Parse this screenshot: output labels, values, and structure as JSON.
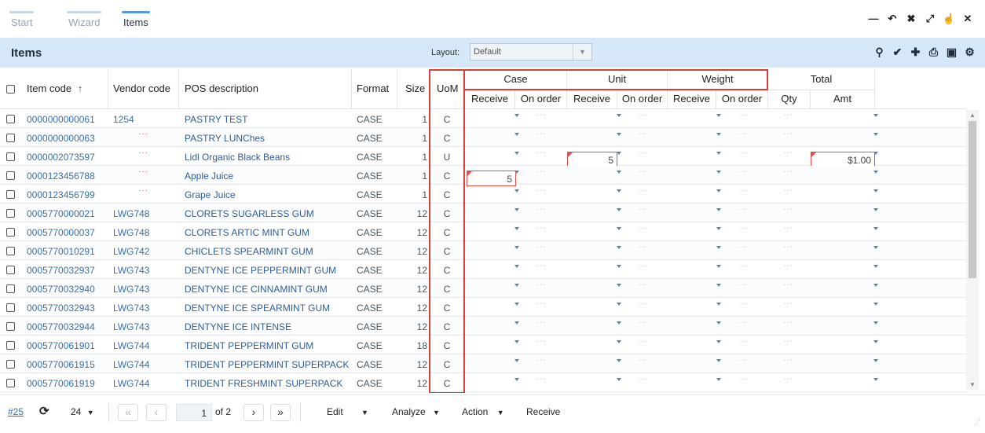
{
  "wizard": {
    "steps": [
      {
        "label": "Start"
      },
      {
        "label": "Wizard"
      },
      {
        "label": "Items"
      }
    ],
    "tools": [
      "minimize-icon",
      "undo-icon",
      "collapse-icon",
      "expand-icon",
      "pointer-icon",
      "close-icon"
    ]
  },
  "header": {
    "title": "Items",
    "layout_label": "Layout:",
    "layout_value": "Default",
    "tools": [
      "search-icon",
      "check-icon",
      "plus-icon",
      "print-icon",
      "excel-icon",
      "settings-icon"
    ]
  },
  "columns": {
    "item_code": "Item code",
    "vendor_code": "Vendor code",
    "pos_description": "POS description",
    "format": "Format",
    "size": "Size",
    "uom": "UoM",
    "groups": {
      "case": "Case",
      "unit": "Unit",
      "weight": "Weight",
      "total": "Total"
    },
    "sub": {
      "receive": "Receive",
      "on_order": "On order",
      "qty": "Qty",
      "amt": "Amt"
    },
    "sort_indicator": "↑"
  },
  "placeholder_dots": "···",
  "rows": [
    {
      "item_code": "0000000000061",
      "vendor_code": "1254",
      "description": "PASTRY TEST",
      "format": "CASE",
      "size": "1",
      "uom": "C"
    },
    {
      "item_code": "0000000000063",
      "vendor_code": "···",
      "description": "PASTRY LUNChes",
      "format": "CASE",
      "size": "1",
      "uom": "C"
    },
    {
      "item_code": "0000002073597",
      "vendor_code": "···",
      "description": "Lidl Organic Black Beans",
      "format": "CASE",
      "size": "1",
      "uom": "U",
      "unit_receive": "5",
      "total_amt": "$1.00"
    },
    {
      "item_code": "0000123456788",
      "vendor_code": "···",
      "description": "Apple Juice",
      "format": "CASE",
      "size": "1",
      "uom": "C",
      "case_receive": "5"
    },
    {
      "item_code": "0000123456799",
      "vendor_code": "···",
      "description": "Grape Juice",
      "format": "CASE",
      "size": "1",
      "uom": "C"
    },
    {
      "item_code": "0005770000021",
      "vendor_code": "LWG748",
      "description": "CLORETS SUGARLESS GUM",
      "format": "CASE",
      "size": "12",
      "uom": "C"
    },
    {
      "item_code": "0005770000037",
      "vendor_code": "LWG748",
      "description": "CLORETS ARTIC MINT GUM",
      "format": "CASE",
      "size": "12",
      "uom": "C"
    },
    {
      "item_code": "0005770010291",
      "vendor_code": "LWG742",
      "description": "CHICLETS SPEARMINT GUM",
      "format": "CASE",
      "size": "12",
      "uom": "C"
    },
    {
      "item_code": "0005770032937",
      "vendor_code": "LWG743",
      "description": "DENTYNE ICE PEPPERMINT GUM",
      "format": "CASE",
      "size": "12",
      "uom": "C"
    },
    {
      "item_code": "0005770032940",
      "vendor_code": "LWG743",
      "description": "DENTYNE ICE CINNAMINT GUM",
      "format": "CASE",
      "size": "12",
      "uom": "C"
    },
    {
      "item_code": "0005770032943",
      "vendor_code": "LWG743",
      "description": "DENTYNE ICE SPEARMINT GUM",
      "format": "CASE",
      "size": "12",
      "uom": "C"
    },
    {
      "item_code": "0005770032944",
      "vendor_code": "LWG743",
      "description": "DENTYNE ICE INTENSE",
      "format": "CASE",
      "size": "12",
      "uom": "C"
    },
    {
      "item_code": "0005770061901",
      "vendor_code": "LWG744",
      "description": "TRIDENT PEPPERMINT GUM",
      "format": "CASE",
      "size": "18",
      "uom": "C"
    },
    {
      "item_code": "0005770061915",
      "vendor_code": "LWG744",
      "description": "TRIDENT PEPPERMINT SUPERPACK",
      "format": "CASE",
      "size": "12",
      "uom": "C"
    },
    {
      "item_code": "0005770061919",
      "vendor_code": "LWG744",
      "description": "TRIDENT FRESHMINT SUPERPACK",
      "format": "CASE",
      "size": "12",
      "uom": "C"
    }
  ],
  "footer": {
    "record_count": "#25",
    "page_size": "24",
    "page_current": "1",
    "page_total": "of 2",
    "menus": [
      {
        "label": "Edit"
      },
      {
        "label": "Analyze"
      },
      {
        "label": "Action"
      },
      {
        "label": "Receive"
      }
    ]
  }
}
